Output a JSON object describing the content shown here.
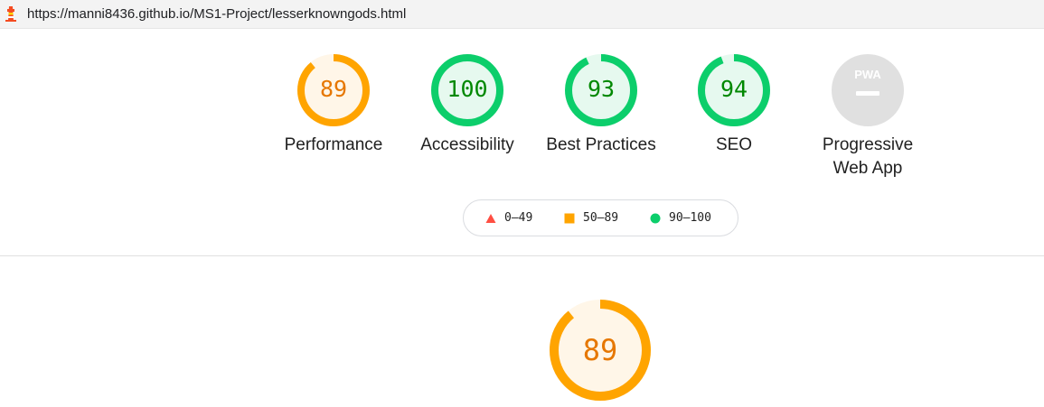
{
  "address_bar": {
    "url": "https://manni8436.github.io/MS1-Project/lesserknowngods.html",
    "icon": "lighthouse-icon"
  },
  "gauges": [
    {
      "label": "Performance",
      "score": "89",
      "value": 89,
      "status": "average"
    },
    {
      "label": "Accessibility",
      "score": "100",
      "value": 100,
      "status": "pass"
    },
    {
      "label": "Best Practices",
      "score": "93",
      "value": 93,
      "status": "pass"
    },
    {
      "label": "SEO",
      "score": "94",
      "value": 94,
      "status": "pass"
    },
    {
      "label_line1": "Progressive",
      "label_line2": "Web App",
      "badge": "PWA",
      "status": "not-applicable"
    }
  ],
  "legend": [
    {
      "range": "0–49",
      "shape": "triangle",
      "color": "#ff4e42"
    },
    {
      "range": "50–89",
      "shape": "square",
      "color": "#ffa400"
    },
    {
      "range": "90–100",
      "shape": "circle",
      "color": "#0cce6b"
    }
  ],
  "main_gauge": {
    "score": "89",
    "value": 89,
    "status": "average"
  },
  "colors": {
    "average_stroke": "#ffa400",
    "average_fill": "#fff6e8",
    "average_text": "#e67700",
    "pass_stroke": "#0cce6b",
    "pass_fill": "#e6f9ef",
    "pass_text": "#008800",
    "pwa_fill": "#e0e0e0"
  }
}
